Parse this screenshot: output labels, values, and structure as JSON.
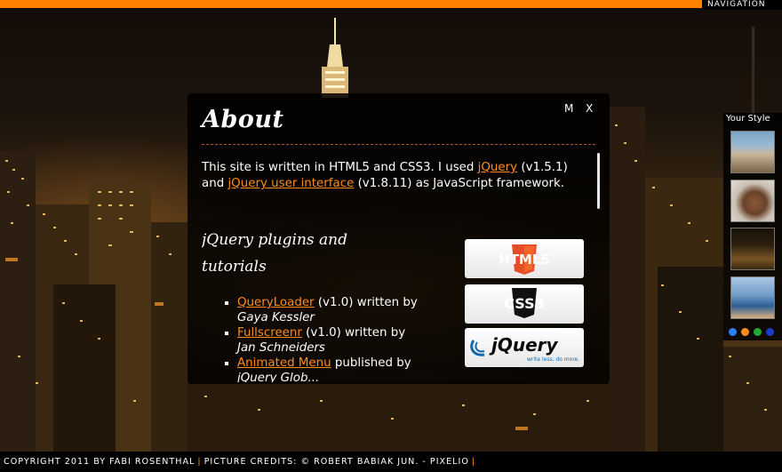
{
  "topbar": {
    "nav_label": "NAVIGATION"
  },
  "style_chooser": {
    "title": "Your Style",
    "thumbnails": [
      "coastal-town-thumbnail",
      "brown-texture-thumbnail",
      "city-night-thumbnail",
      "lake-town-thumbnail"
    ],
    "color_dots": [
      "#2a7fff",
      "#ff8c1a",
      "#22aa33",
      "#1a3cc8"
    ]
  },
  "about_window": {
    "title": "About",
    "minimize_label": "M",
    "close_label": "X",
    "intro_text_1": "This site is written in HTML5 and CSS3. I used ",
    "intro_link_1": "jQuery",
    "intro_text_2": " (v1.5.1) and ",
    "intro_link_2": "jQuery user interface",
    "intro_text_3": " (v1.8.11) as JavaScript framework.",
    "plugins_heading": "jQuery plugins and tutorials",
    "plugins": [
      {
        "link": "QueryLoader",
        "text": " (v1.0) written by ",
        "author": "Gaya Kessler"
      },
      {
        "link": "Fullscreenr",
        "text": " (v1.0) written by ",
        "author": "Jan Schneiders"
      },
      {
        "link": "Animated Menu",
        "text": " published by ",
        "author": "jQuery Glob..."
      }
    ],
    "logos": [
      "HTML5",
      "CSS3",
      "jQuery",
      "write less, do more."
    ],
    "accent_color": "#ff8c1a"
  },
  "footer": {
    "copyright": "COPYRIGHT 2011 BY FABI ROSENTHAL",
    "credits": "PICTURE CREDITS: © ROBERT BABIAK JUN. - PIXELIO"
  }
}
